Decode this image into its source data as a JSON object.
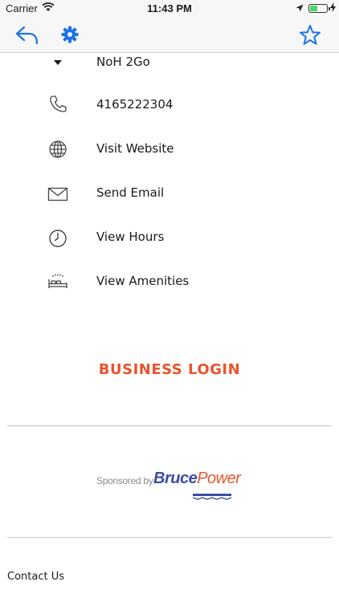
{
  "status_bar": {
    "carrier": "Carrier",
    "time": "11:43 PM",
    "battery_level": 0.45
  },
  "nav": {
    "back_icon": "reply-arrow-icon",
    "settings_icon": "gear-icon",
    "favorite_icon": "star-icon",
    "accent_color": "#1a73e8"
  },
  "info_rows": [
    {
      "label": "NoH 2Go",
      "icon": "dropdown-caret-icon"
    },
    {
      "label": "4165222304",
      "icon": "phone-icon"
    },
    {
      "label": "Visit Website",
      "icon": "globe-icon"
    },
    {
      "label": "Send Email",
      "icon": "envelope-icon"
    },
    {
      "label": "View Hours",
      "icon": "clock-icon"
    },
    {
      "label": "View Amenities",
      "icon": "bed-icon"
    }
  ],
  "business_login": {
    "label": "BUSINESS LOGIN",
    "color": "#e8542c"
  },
  "sponsor": {
    "prefix": "Sponsored by",
    "brand_first": "Bruce",
    "brand_second": "Power"
  },
  "footer": {
    "contact_label": "Contact Us"
  }
}
